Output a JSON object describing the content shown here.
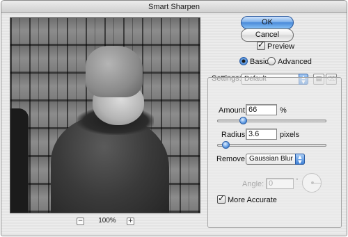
{
  "window": {
    "title": "Smart Sharpen"
  },
  "preview": {
    "zoom": "100%",
    "zoom_out": "−",
    "zoom_in": "+"
  },
  "buttons": {
    "ok": "OK",
    "cancel": "Cancel"
  },
  "preview_checkbox": {
    "label": "Preview",
    "checked": true
  },
  "mode": {
    "options": [
      "Basic",
      "Advanced"
    ],
    "selected": "Basic"
  },
  "settings": {
    "label": "Settings:",
    "value": "Default"
  },
  "amount": {
    "label": "Amount:",
    "value": "66",
    "unit": "%",
    "slider_fraction": 0.22
  },
  "radius": {
    "label": "Radius:",
    "value": "3.6",
    "unit": "pixels",
    "slider_fraction": 0.05
  },
  "remove": {
    "label": "Remove:",
    "value": "Gaussian Blur"
  },
  "angle": {
    "label": "Angle:",
    "value": "0",
    "unit": "°",
    "enabled": false
  },
  "more_accurate": {
    "label": "More Accurate",
    "checked": true
  },
  "colors": {
    "ok_blue": "#4a8ad9",
    "accent": "#3f82d6"
  }
}
